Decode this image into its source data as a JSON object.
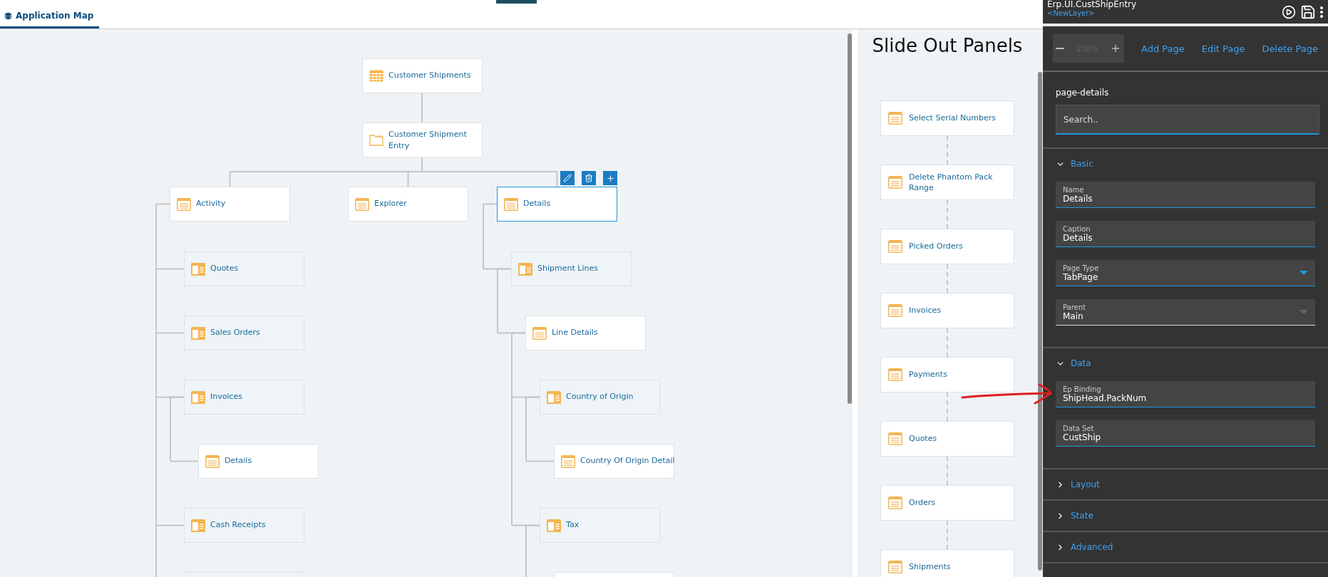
{
  "tab": {
    "label": "Application Map",
    "selected": true
  },
  "map": {
    "root": {
      "label": "Customer Shipments",
      "kind": "grid",
      "selected": false,
      "children": [
        {
          "label": "Customer Shipment Entry",
          "kind": "folder",
          "selected": false,
          "children": [
            {
              "label": "Activity",
              "kind": "page",
              "selected": false,
              "children": [
                {
                  "label": "Quotes",
                  "kind": "split",
                  "selected": false
                },
                {
                  "label": "Sales Orders",
                  "kind": "split",
                  "selected": false
                },
                {
                  "label": "Invoices",
                  "kind": "split",
                  "selected": false,
                  "children": [
                    {
                      "label": "Details",
                      "kind": "page",
                      "selected": false
                    }
                  ]
                },
                {
                  "label": "Cash Receipts",
                  "kind": "split",
                  "selected": false
                },
                {
                  "kind": "split",
                  "selected": false
                }
              ]
            },
            {
              "label": "Explorer",
              "kind": "page",
              "selected": false
            },
            {
              "label": "Details",
              "kind": "page",
              "selected": true,
              "children": [
                {
                  "label": "Shipment Lines",
                  "kind": "split",
                  "selected": false,
                  "children": [
                    {
                      "label": "Line Details",
                      "kind": "page",
                      "selected": false,
                      "children": [
                        {
                          "label": "Country of Origin",
                          "kind": "split",
                          "selected": false,
                          "children": [
                            {
                              "label": "Country Of Origin Detail",
                              "kind": "page",
                              "selected": false
                            }
                          ]
                        },
                        {
                          "label": "Tax",
                          "kind": "split",
                          "selected": false,
                          "children": [
                            {
                              "kind": "page",
                              "selected": false
                            }
                          ]
                        }
                      ]
                    }
                  ]
                }
              ]
            }
          ]
        }
      ]
    }
  },
  "slide_out": {
    "title": "Slide Out Panels",
    "panels": [
      {
        "label": "Select Serial Numbers",
        "selected": false
      },
      {
        "label": "Delete Phantom Pack Range",
        "selected": false
      },
      {
        "label": "Picked Orders",
        "selected": false
      },
      {
        "label": "Invoices",
        "selected": false
      },
      {
        "label": "Payments",
        "selected": false
      },
      {
        "label": "Quotes",
        "selected": false
      },
      {
        "label": "Orders",
        "selected": false
      },
      {
        "label": "Shipments",
        "selected": false
      }
    ]
  },
  "designer": {
    "title": "Erp.UI.CustShipEntry",
    "layer": "<NewLayer>",
    "zoom": "100%",
    "actions": [
      "Add Page",
      "Edit Page",
      "Delete Page"
    ],
    "panel_title": "page-details",
    "search": {
      "placeholder": "Search.."
    },
    "sections": [
      {
        "title": "Basic",
        "expanded": true,
        "fields": [
          {
            "label": "Name",
            "value": "Details",
            "kind": "text",
            "disabled": false
          },
          {
            "label": "Caption",
            "value": "Details",
            "kind": "text",
            "disabled": false
          },
          {
            "label": "Page Type",
            "value": "TabPage",
            "kind": "select",
            "disabled": false
          },
          {
            "label": "Parent",
            "value": "Main",
            "kind": "select",
            "disabled": true
          }
        ]
      },
      {
        "title": "Data",
        "expanded": true,
        "fields": [
          {
            "label": "Ep Binding",
            "value": "ShipHead.PackNum",
            "kind": "text",
            "disabled": false
          },
          {
            "label": "Data Set",
            "value": "CustShip",
            "kind": "text",
            "disabled": false
          }
        ]
      },
      {
        "title": "Layout",
        "expanded": false
      },
      {
        "title": "State",
        "expanded": false
      },
      {
        "title": "Advanced",
        "expanded": false
      }
    ]
  }
}
